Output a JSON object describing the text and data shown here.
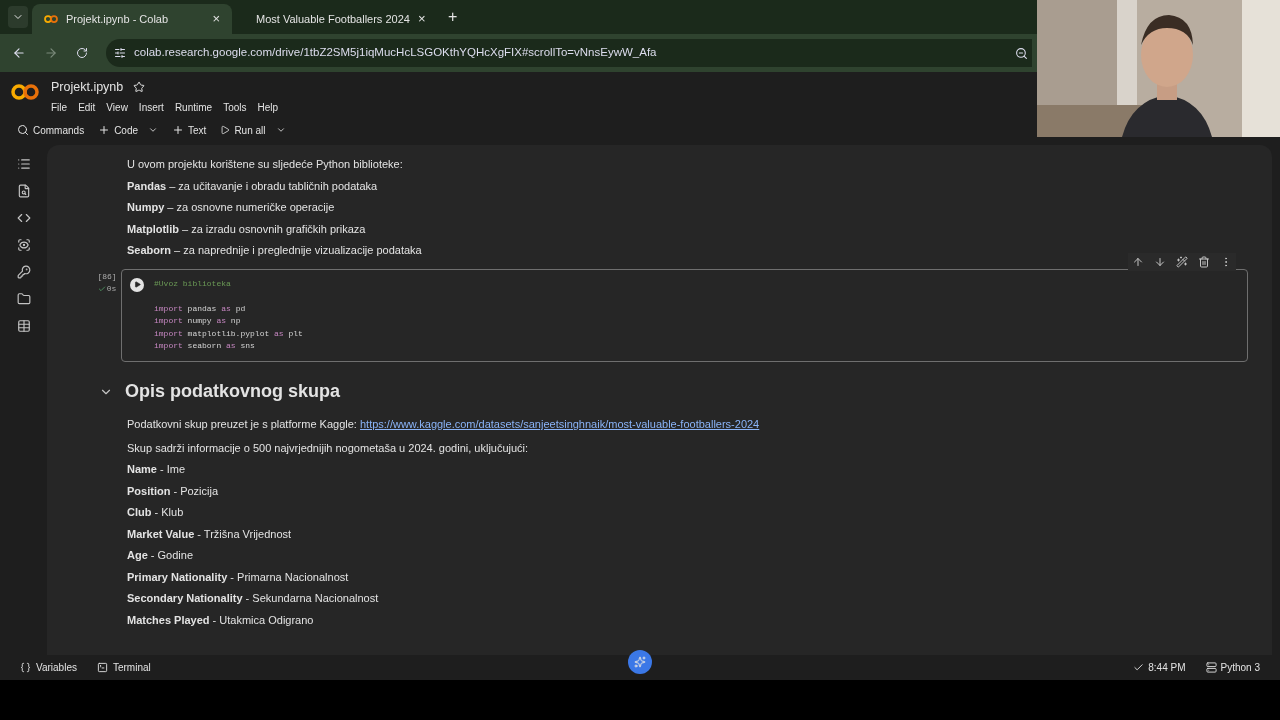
{
  "browser": {
    "tabs": [
      {
        "title": "Projekt.ipynb - Colab",
        "selected": true,
        "close": "×"
      },
      {
        "title": "Most Valuable Footballers 2024",
        "selected": false,
        "close": "×"
      }
    ],
    "new_tab": "+",
    "address": "colab.research.google.com/drive/1tbZ2SM5j1iqMucHcLSGOKthYQHcXgFIX#scrollTo=vNnsEywW_Afa"
  },
  "notebook": {
    "title": "Projekt.ipynb",
    "menu": [
      "File",
      "Edit",
      "View",
      "Insert",
      "Runtime",
      "Tools",
      "Help"
    ],
    "toolbar": [
      {
        "label": "Commands",
        "kind": "search",
        "caret": false
      },
      {
        "label": "Code",
        "kind": "add",
        "caret": true
      },
      {
        "label": "Text",
        "kind": "add",
        "caret": false
      },
      {
        "label": "Run all",
        "kind": "run",
        "caret": true
      }
    ]
  },
  "cells": [
    {
      "kind": "markdown",
      "paragraphs": [
        "U ovom projektu korištene su sljedeće Python biblioteke:",
        "**Pandas** – za učitavanje i obradu tabličnih podataka",
        "**Numpy** – za osnovne numeričke operacije",
        "**Matplotlib** – za izradu osnovnih grafičkih prikaza",
        "**Seaborn** – za naprednije i preglednije vizualizacije podataka"
      ]
    },
    {
      "kind": "code",
      "count": "[86]",
      "time": "0s",
      "lines": [
        [
          {
            "text": "#Uvoz biblioteka",
            "kind": "comment"
          }
        ],
        [
          {
            "text": "import",
            "kind": "keyword"
          },
          {
            "text": " pandas ",
            "kind": "plain"
          },
          {
            "text": "as",
            "kind": "keyword"
          },
          {
            "text": " pd",
            "kind": "plain"
          }
        ],
        [
          {
            "text": "import",
            "kind": "keyword"
          },
          {
            "text": " numpy ",
            "kind": "plain"
          },
          {
            "text": "as",
            "kind": "keyword"
          },
          {
            "text": " np",
            "kind": "plain"
          }
        ],
        [
          {
            "text": "import",
            "kind": "keyword"
          },
          {
            "text": " matplotlib.pyplot ",
            "kind": "plain"
          },
          {
            "text": "as",
            "kind": "keyword"
          },
          {
            "text": " plt",
            "kind": "plain"
          }
        ],
        [
          {
            "text": "import",
            "kind": "keyword"
          },
          {
            "text": " seaborn ",
            "kind": "plain"
          },
          {
            "text": "as",
            "kind": "keyword"
          },
          {
            "text": " sns",
            "kind": "plain"
          }
        ]
      ]
    },
    {
      "kind": "heading",
      "text": "Opis podatkovnog skupa",
      "expanded": true
    },
    {
      "kind": "markdown",
      "paragraphs": [
        "Podatkovni skup preuzet je s platforme Kaggle: "
      ],
      "link": "https://www.kaggle.com/datasets/sanjeetsinghnaik/most-valuable-footballers-2024"
    },
    {
      "kind": "markdown",
      "paragraphs": [
        "Skup sadrži informacije o 500 najvrjednijih nogometaša u 2024. godini, uključujući:",
        "**Name** - Ime",
        "**Position** - Pozicija",
        "**Club** - Klub",
        "**Market Value** - Tržišna Vrijednost",
        "**Age** - Godine",
        "**Primary Nationality** - Primarna Nacionalnost",
        "**Secondary Nationality** - Sekundarna Nacionalnost",
        "**Matches Played** - Utakmica Odigrano"
      ]
    }
  ],
  "status_bar": {
    "left": [
      "Variables",
      "Terminal"
    ],
    "time": "8:44 PM",
    "runtime": "Python 3"
  }
}
